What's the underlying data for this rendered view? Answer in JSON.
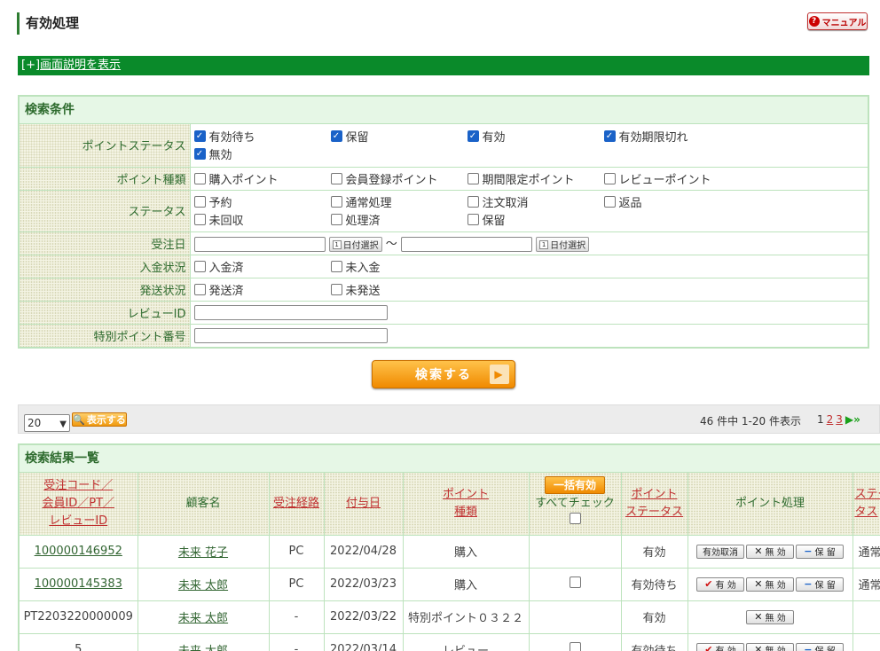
{
  "page": {
    "title": "有効処理",
    "manual_label": "マニュアル"
  },
  "help_bar": {
    "prefix": "[+]",
    "link": "画面説明を表示"
  },
  "search": {
    "heading": "検索条件",
    "point_status": {
      "label": "ポイントステータス",
      "options": [
        {
          "label": "有効待ち",
          "checked": true
        },
        {
          "label": "保留",
          "checked": true
        },
        {
          "label": "有効",
          "checked": true
        },
        {
          "label": "有効期限切れ",
          "checked": true
        },
        {
          "label": "無効",
          "checked": true
        }
      ]
    },
    "point_type": {
      "label": "ポイント種類",
      "options": [
        {
          "label": "購入ポイント",
          "checked": false
        },
        {
          "label": "会員登録ポイント",
          "checked": false
        },
        {
          "label": "期間限定ポイント",
          "checked": false
        },
        {
          "label": "レビューポイント",
          "checked": false
        }
      ]
    },
    "status": {
      "label": "ステータス",
      "options": [
        {
          "label": "予約",
          "checked": false
        },
        {
          "label": "通常処理",
          "checked": false
        },
        {
          "label": "注文取消",
          "checked": false
        },
        {
          "label": "返品",
          "checked": false
        },
        {
          "label": "未回収",
          "checked": false
        },
        {
          "label": "処理済",
          "checked": false
        },
        {
          "label": "保留",
          "checked": false
        }
      ]
    },
    "order_date": {
      "label": "受注日",
      "date_button": "日付選択",
      "separator": "～",
      "from": "",
      "to": ""
    },
    "payment": {
      "label": "入金状況",
      "options": [
        {
          "label": "入金済",
          "checked": false
        },
        {
          "label": "未入金",
          "checked": false
        }
      ]
    },
    "shipping": {
      "label": "発送状況",
      "options": [
        {
          "label": "発送済",
          "checked": false
        },
        {
          "label": "未発送",
          "checked": false
        }
      ]
    },
    "review_id": {
      "label": "レビューID",
      "value": ""
    },
    "special_point_no": {
      "label": "特別ポイント番号",
      "value": ""
    },
    "submit_label": "検索する"
  },
  "toolbar": {
    "per_page": "20",
    "show_label": "表示する",
    "count_text": "46 件中 1-20 件表示",
    "pages": [
      "1",
      "2",
      "3"
    ],
    "current_page": "1"
  },
  "results": {
    "heading": "検索結果一覧",
    "columns": {
      "code": [
        "受注コード／",
        "会員ID／PT／",
        "レビューID"
      ],
      "customer": "顧客名",
      "route": "受注経路",
      "date": "付与日",
      "type": [
        "ポイント",
        "種類"
      ],
      "bulk_label": "一括有効",
      "check_all": "すべてチェック",
      "pstatus": [
        "ポイント",
        "ステータス"
      ],
      "process": "ポイント処理",
      "status": "ステータス"
    },
    "buttons": {
      "cancel": "有効取消",
      "valid": "有 効",
      "invalid": "無 効",
      "hold": "保 留"
    },
    "rows": [
      {
        "code": "100000146952",
        "code_link": true,
        "customer": "未来 花子",
        "route": "PC",
        "date": "2022/04/28",
        "type": "購入",
        "checkbox": false,
        "pstatus": "有効",
        "actions": [
          "cancel",
          "invalid",
          "hold"
        ],
        "status": "通常処理"
      },
      {
        "code": "100000145383",
        "code_link": true,
        "customer": "未来 太郎",
        "route": "PC",
        "date": "2022/03/23",
        "type": "購入",
        "checkbox": true,
        "pstatus": "有効待ち",
        "actions": [
          "valid",
          "invalid",
          "hold"
        ],
        "status": "通常処理"
      },
      {
        "code": "PT2203220000009",
        "code_link": false,
        "customer": "未来 太郎",
        "route": "-",
        "date": "2022/03/22",
        "type": "特別ポイント０３２２",
        "checkbox": false,
        "pstatus": "有効",
        "actions": [
          "invalid"
        ],
        "status": ""
      },
      {
        "code": "5",
        "code_link": false,
        "customer": "未来 太郎",
        "route": "-",
        "date": "2022/03/14",
        "type": "レビュー",
        "checkbox": true,
        "pstatus": "有効待ち",
        "actions": [
          "valid",
          "invalid",
          "hold"
        ],
        "status": ""
      }
    ]
  }
}
